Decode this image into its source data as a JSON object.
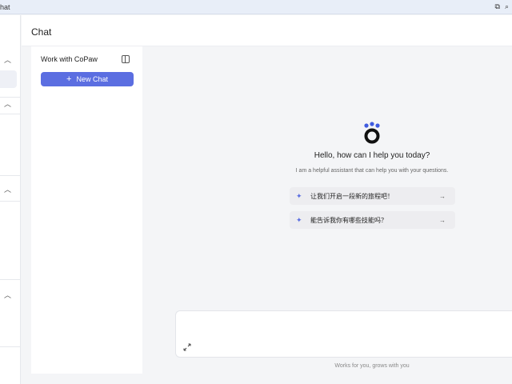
{
  "browser": {
    "tab_title": "hat",
    "translate_icon": "translate-icon",
    "zoom_icon": "zoom-icon"
  },
  "header": {
    "title": "Chat"
  },
  "chat_panel": {
    "title": "Work with CoPaw",
    "new_chat_label": "New Chat"
  },
  "welcome": {
    "title": "Hello, how can I help you today?",
    "subtitle": "I am a helpful assistant that can help you with your questions.",
    "suggestions": [
      {
        "text": "让我们开启一段新的旅程吧！"
      },
      {
        "text": "能告诉我你有哪些技能吗？"
      }
    ]
  },
  "input": {
    "placeholder": ""
  },
  "footer": {
    "text": "Works for you, grows with you"
  },
  "colors": {
    "accent": "#5b6ee1",
    "background": "#f4f5f7"
  }
}
